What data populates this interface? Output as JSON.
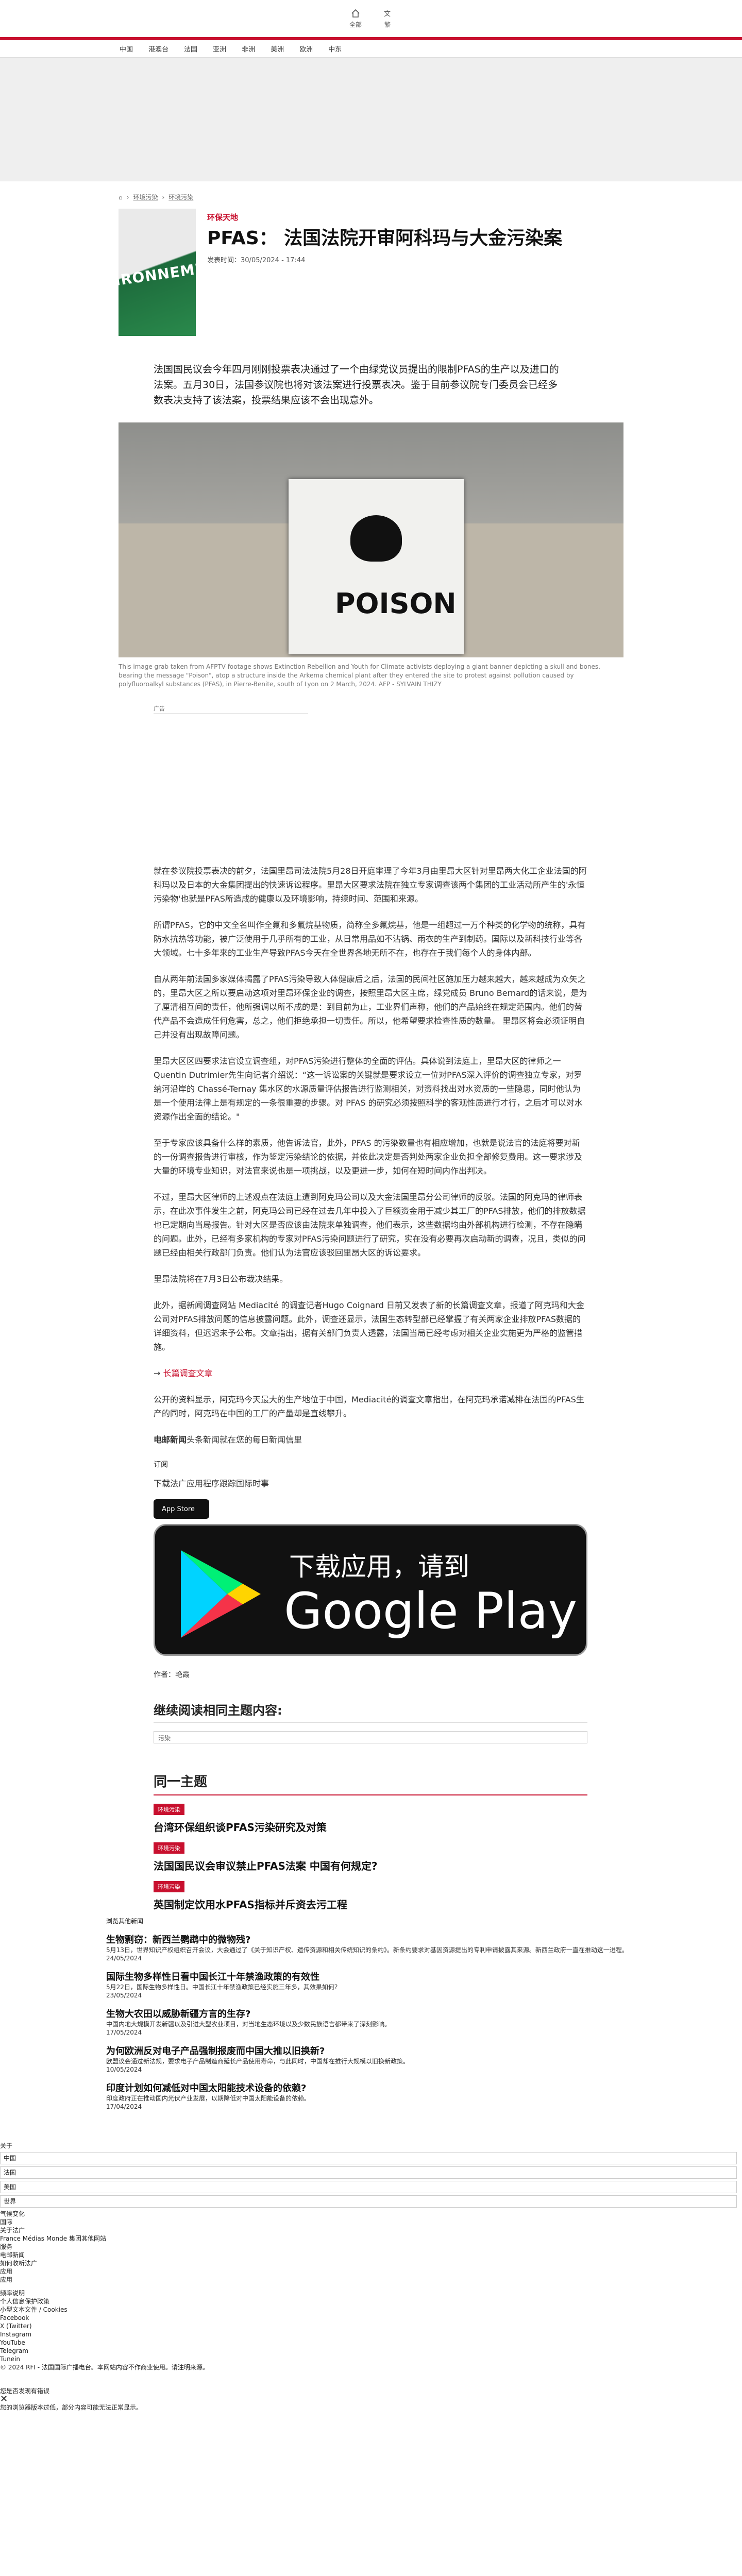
{
  "header": {
    "icons": [
      {
        "icon": "home-icon",
        "label": "全部"
      },
      {
        "icon": "translate-icon",
        "label": "繁"
      }
    ]
  },
  "nav": [
    "中国",
    "港澳台",
    "法国",
    "亚洲",
    "非洲",
    "美洲",
    "欧洲",
    "中东"
  ],
  "breadcrumb": [
    "环境污染",
    "环境污染"
  ],
  "article": {
    "category": "环保天地",
    "title": "PFAS： 法国法院开审阿科玛与大金污染案",
    "thumb_text": "IRONNEMENT",
    "date_label": "发表时间：",
    "date": "30/05/2024 - 17:44",
    "lead": "法国国民议会今年四月刚刚投票表决通过了一个由绿党议员提出的限制PFAS的生产以及进口的法案。五月30日，法国参议院也将对该法案进行投票表决。鉴于目前参议院专门委员会已经多数表决支持了该法案，投票结果应该不会出现意外。",
    "photo_text": "POISON",
    "caption": "This image grab taken from AFPTV footage shows Extinction Rebellion and Youth for Climate activists deploying a giant banner depicting a skull and bones, bearing the message \"Poison\", atop a structure inside the Arkema chemical plant after they entered the site to protest against pollution caused by polyfluoroalkyl substances (PFAS), in Pierre-Benite, south of Lyon on 2 March, 2024. AFP - SYLVAIN THIZY",
    "ad_label": "广告",
    "paragraphs": [
      "就在参议院投票表决的前夕，法国里昂司法法院5月28日开庭审理了今年3月由里昂大区针对里昂两大化工企业法国的阿科玛以及日本的大金集团提出的快速诉讼程序。里昂大区要求法院在独立专家调查该两个集团的工业活动所产生的'永恒污染物'也就是PFAS所造成的健康以及环境影响，持续时间、范围和来源。",
      "所谓PFAS，它的中文全名叫作全氟和多氟烷基物质，简称全多氟烷基，他是一组超过一万个种类的化学物的统称，具有防水抗热等功能，被广泛使用于几乎所有的工业，从日常用品如不沾锅、雨衣的生产到制药。国际以及新科技行业等各大领域。七十多年来的工业生产导致PFAS今天在全世界各地无所不在，也存在于我们每个人的身体内部。",
      "自从两年前法国多家媒体揭露了PFAS污染导致人体健康后之后，法国的民间社区施加压力越来越大，越来越成为众矢之的，里昂大区之所以要启动这项对里昂环保企业的调查，按照里昂大区主席，绿党成员 Bruno Bernard的话来说，是为了厘清相互间的责任，他所强调以所不成的是：到目前为止，工业界们声称，他们的产品始终在规定范围内。他们的替代产品不会造成任何危害，总之，他们拒绝承担一切责任。所以，他希望要求检查性质的数量。 里昂区将会必须证明自己并没有出现故障问题。",
      "里昂大区区四要求法官设立调查组，对PFAS污染进行整体的全面的评估。具体说到法庭上，里昂大区的律师之一Quentin Dutrimier先生向记者介绍说：“这一诉讼案的关键就是要求设立一位对PFAS深入评价的调查独立专家，对罗纳河沿岸的 Chassé-Ternay 集水区的水源质量评估报告进行监测相关，对资料找出对水资质的一些隐患，同时他认为是一个使用法律上是有规定的一条很重要的步骤。对 PFAS 的研究必须按照科学的客观性质进行才行，之后才可以对水资源作出全面的结论。\"",
      "至于专家应该具备什么样的素质，他告诉法官，此外，PFAS 的污染数量也有相应增加，也就是说法官的法庭将要对新的一份调查报告进行审核，作为鉴定污染结论的依据，并依此决定是否判处两家企业负担全部修复费用。这一要求涉及大量的环境专业知识，对法官来说也是一项挑战，以及更进一步，如何在短时间内作出判决。",
      "不过，里昂大区律师的上述观点在法庭上遭到阿克玛公司以及大金法国里昂分公司律师的反驳。法国的阿克玛的律师表示，在此次事件发生之前，阿克玛公司已经在过去几年中投入了巨额资金用于减少其工厂的PFAS排放，他们的排放数据也已定期向当局报告。针对大区是否应该由法院来单独调查，他们表示，这些数据均由外部机构进行检测，不存在隐瞒的问题。此外，已经有多家机构的专家对PFAS污染问题进行了研究，实在没有必要再次启动新的调查，况且，类似的问题已经由相关行政部门负责。他们认为法官应该驳回里昂大区的诉讼要求。",
      "里昂法院将在7月3日公布裁决结果。",
      "此外，据新闻调查网站 Mediacité 的调查记者Hugo Coignard 日前又发表了新的长篇调查文章，报道了阿克玛和大金公司对PFAS排放问题的信息披露问题。此外，调查还显示，法国生态转型部已经掌握了有关两家企业排放PFAS数据的详细资料，但迟迟未予公布。文章指出，据有关部门负责人透露，法国当局已经考虑对相关企业实施更为严格的监管措施。",
      "公开的资料显示，阿克玛今天最大的生产地位于中国，Mediacité的调查文章指出，在阿克玛承诺减排在法国的PFAS生产的同时，阿克玛在中国的工厂的产量却是直线攀升。"
    ],
    "link_text": "长篇调查文章",
    "newsletter_bold": "电邮新闻",
    "newsletter_rest": "头条新闻就在您的每日新闻信里",
    "subscribe": "订阅",
    "download_text": "下载法广应用程序跟踪国际时事",
    "appstore": "App Store",
    "gplay_line1": "下载应用，请到",
    "gplay_line2": "Google Play",
    "author_label": "作者：",
    "author": "艳霞"
  },
  "related": {
    "title": "继续阅读相同主题内容:",
    "tag": "污染"
  },
  "same_topic": {
    "title": "同一主题",
    "items": [
      {
        "badge": "环境污染",
        "title": "台湾环保组织谈PFAS污染研究及对策"
      },
      {
        "badge": "环境污染",
        "title": "法国国民议会审议禁止PFAS法案 中国有何规定?"
      },
      {
        "badge": "环境污染",
        "title": "英国制定饮用水PFAS指标并斥资去污工程"
      }
    ]
  },
  "more": {
    "label": "浏览其他新闻",
    "items": [
      {
        "title": "生物剽窃：新西兰鹦鹉中的微物残?",
        "desc": "5月13日，世界知识产权组织召开会议，大会通过了《关于知识产权、遗传资源和相关传统知识的条约》。新条约要求对基因资源提出的专利申请披露其来源。新西兰政府一直在推动这一进程。",
        "date": "24/05/2024"
      },
      {
        "title": "国际生物多样性日看中国长江十年禁渔政策的有效性",
        "desc": "5月22日，国际生物多样性日。中国长江十年禁渔政策已经实施三年多，其效果如何？",
        "date": "23/05/2024"
      },
      {
        "title": "生物大农田以威胁新疆方言的生存?",
        "desc": "中国内地大规模开发新疆以及引进大型农业项目，对当地生态环境以及少数民族语言都带来了深刻影响。",
        "date": "17/05/2024"
      },
      {
        "title": "为何欧洲反对电子产品强制报废而中国大推以旧换新?",
        "desc": "欧盟议会通过新法规，要求电子产品制造商延长产品使用寿命，与此同时，中国却在推行大规模以旧换新政策。",
        "date": "10/05/2024"
      },
      {
        "title": "印度计划如何减低对中国太阳能技术设备的依赖?",
        "desc": "印度政府正在推动国内光伏产业发展，以期降低对中国太阳能设备的依赖。",
        "date": "17/04/2024"
      }
    ]
  },
  "footer": {
    "label1": "关于",
    "nav_inputs": [
      "中国",
      "法国",
      "美国",
      "世界"
    ],
    "misc_label": "气候变化",
    "links1": [
      "国际",
      "关于法广",
      "France Médias Monde 集团其他网站"
    ],
    "services_label": "服务",
    "services": [
      "电邮新闻",
      "如何收听法广",
      "应用",
      "应用"
    ],
    "social_label": "频率说明",
    "social": [
      "个人信息保护政策",
      "小型文本文件 / Cookies",
      "Facebook",
      "X (Twitter)",
      "Instagram",
      "YouTube",
      "Telegram",
      "Tunein"
    ],
    "copyright": "© 2024 RFI - 法国国际广播电台。本网站内容不作商业使用。请注明来源。",
    "feedback": "您是否发现有错误",
    "notice": "您的浏览器版本过低，部分内容可能无法正常显示。"
  }
}
